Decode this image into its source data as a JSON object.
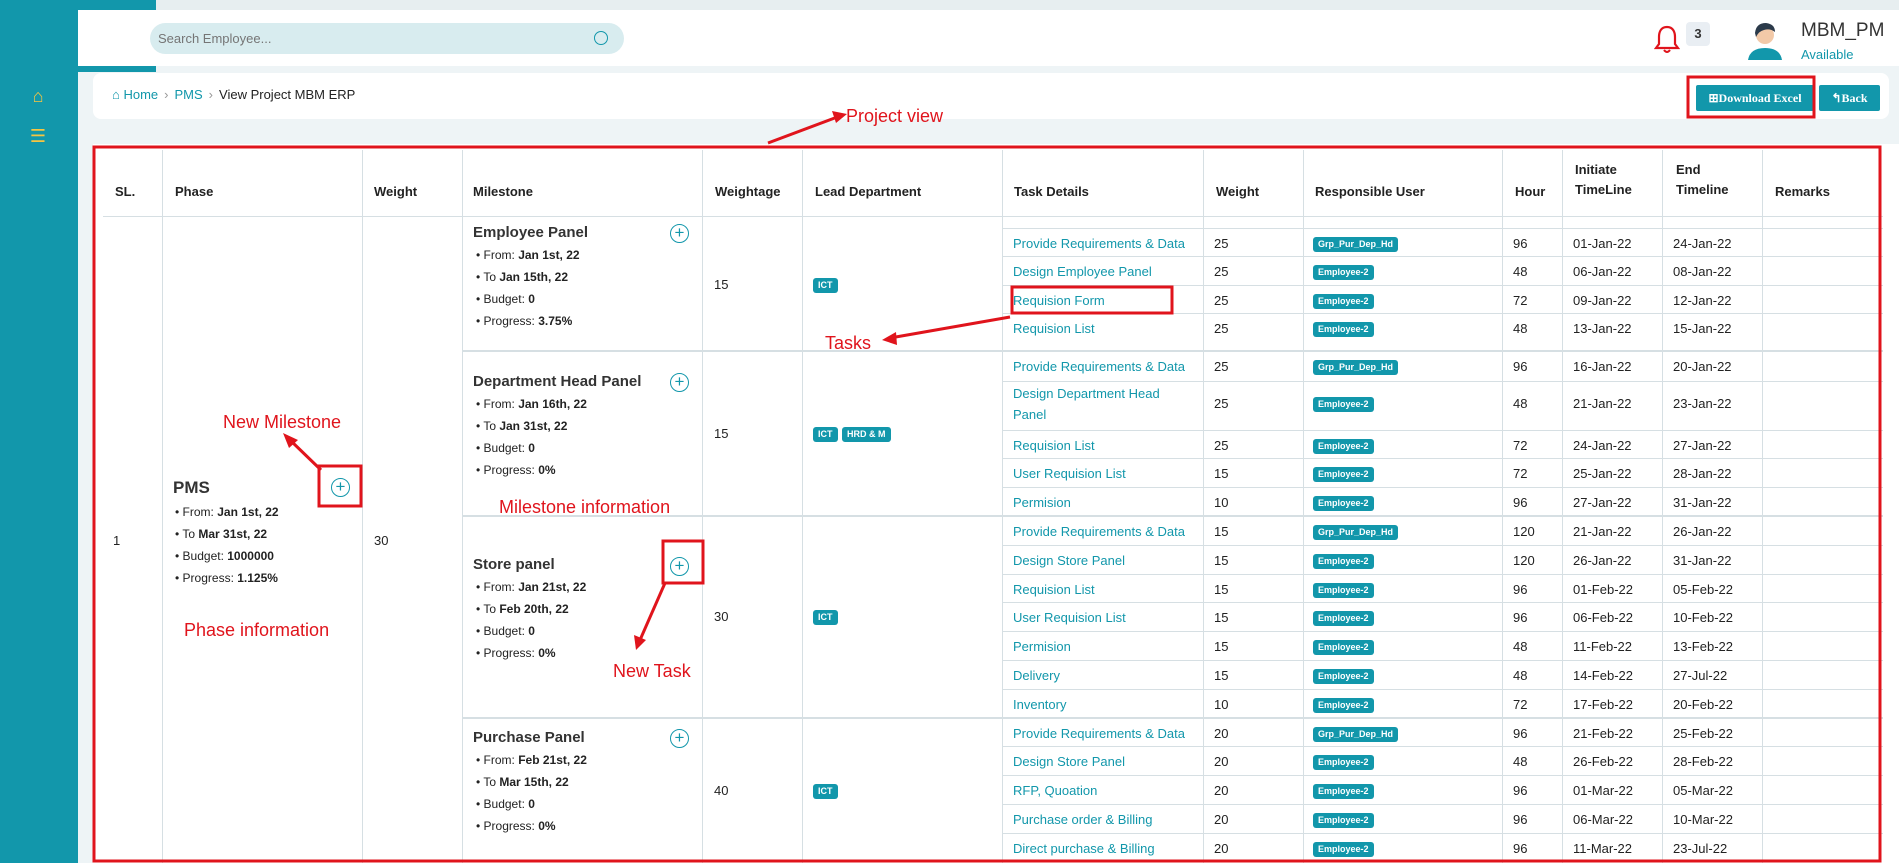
{
  "header": {
    "search_placeholder": "Search Employee...",
    "notification_count": "3",
    "user_name": "MBM_PM",
    "user_status": "Available"
  },
  "breadcrumb": {
    "home": "Home",
    "pms": "PMS",
    "current": "View Project MBM ERP"
  },
  "actions": {
    "download_excel": "⊞Download Excel",
    "back": "↰Back"
  },
  "table_headers": {
    "sl": "SL.",
    "phase": "Phase",
    "weight": "Weight",
    "milestone": "Milestone",
    "weightage": "Weightage",
    "lead_department": "Lead Department",
    "task_details": "Task Details",
    "task_weight": "Weight",
    "responsible_user": "Responsible User",
    "hour": "Hour",
    "initiate_timeline": "Initiate TimeLine",
    "end_timeline": "End Timeline",
    "remarks": "Remarks"
  },
  "phase": {
    "sl": "1",
    "name": "PMS",
    "weight": "30",
    "from_label": "From: ",
    "from": "Jan 1st, 22",
    "to_label": "To ",
    "to": "Mar 31st, 22",
    "budget_label": "Budget: ",
    "budget": "1000000",
    "progress_label": "Progress: ",
    "progress": "1.125%"
  },
  "milestones": [
    {
      "name": "Employee Panel",
      "from": "Jan 1st, 22",
      "to": "Jan 15th, 22",
      "budget": "0",
      "progress": "3.75%",
      "weightage": "15",
      "departments": [
        "ICT"
      ]
    },
    {
      "name": "Department Head Panel",
      "from": "Jan 16th, 22",
      "to": "Jan 31st, 22",
      "budget": "0",
      "progress": "0%",
      "weightage": "15",
      "departments": [
        "ICT",
        "HRD & M"
      ]
    },
    {
      "name": "Store panel",
      "from": "Jan 21st, 22",
      "to": "Feb 20th, 22",
      "budget": "0",
      "progress": "0%",
      "weightage": "30",
      "departments": [
        "ICT"
      ]
    },
    {
      "name": "Purchase Panel",
      "from": "Feb 21st, 22",
      "to": "Mar 15th, 22",
      "budget": "0",
      "progress": "0%",
      "weightage": "40",
      "departments": [
        "ICT"
      ]
    }
  ],
  "tasks": [
    {
      "name": "Provide Requirements & Data",
      "weight": "25",
      "user": "Grp_Pur_Dep_Hd",
      "hour": "96",
      "start": "01-Jan-22",
      "end": "24-Jan-22"
    },
    {
      "name": "Design Employee Panel",
      "weight": "25",
      "user": "Employee-2",
      "hour": "48",
      "start": "06-Jan-22",
      "end": "08-Jan-22"
    },
    {
      "name": "Requision Form",
      "weight": "25",
      "user": "Employee-2",
      "hour": "72",
      "start": "09-Jan-22",
      "end": "12-Jan-22"
    },
    {
      "name": "Requision List",
      "weight": "25",
      "user": "Employee-2",
      "hour": "48",
      "start": "13-Jan-22",
      "end": "15-Jan-22"
    },
    {
      "name": "Provide Requirements & Data",
      "weight": "25",
      "user": "Grp_Pur_Dep_Hd",
      "hour": "96",
      "start": "16-Jan-22",
      "end": "20-Jan-22"
    },
    {
      "name": "Design Department Head Panel",
      "weight": "25",
      "user": "Employee-2",
      "hour": "48",
      "start": "21-Jan-22",
      "end": "23-Jan-22"
    },
    {
      "name": "Requision List",
      "weight": "25",
      "user": "Employee-2",
      "hour": "72",
      "start": "24-Jan-22",
      "end": "27-Jan-22"
    },
    {
      "name": "User Requision List",
      "weight": "15",
      "user": "Employee-2",
      "hour": "72",
      "start": "25-Jan-22",
      "end": "28-Jan-22"
    },
    {
      "name": "Permision",
      "weight": "10",
      "user": "Employee-2",
      "hour": "96",
      "start": "27-Jan-22",
      "end": "31-Jan-22"
    },
    {
      "name": "Provide Requirements & Data",
      "weight": "15",
      "user": "Grp_Pur_Dep_Hd",
      "hour": "120",
      "start": "21-Jan-22",
      "end": "26-Jan-22"
    },
    {
      "name": "Design Store Panel",
      "weight": "15",
      "user": "Employee-2",
      "hour": "120",
      "start": "26-Jan-22",
      "end": "31-Jan-22"
    },
    {
      "name": "Requision List",
      "weight": "15",
      "user": "Employee-2",
      "hour": "96",
      "start": "01-Feb-22",
      "end": "05-Feb-22"
    },
    {
      "name": "User Requision List",
      "weight": "15",
      "user": "Employee-2",
      "hour": "96",
      "start": "06-Feb-22",
      "end": "10-Feb-22"
    },
    {
      "name": "Permision",
      "weight": "15",
      "user": "Employee-2",
      "hour": "48",
      "start": "11-Feb-22",
      "end": "13-Feb-22"
    },
    {
      "name": "Delivery",
      "weight": "15",
      "user": "Employee-2",
      "hour": "48",
      "start": "14-Feb-22",
      "end": "27-Jul-22"
    },
    {
      "name": "Inventory",
      "weight": "10",
      "user": "Employee-2",
      "hour": "72",
      "start": "17-Feb-22",
      "end": "20-Feb-22"
    },
    {
      "name": "Provide Requirements & Data",
      "weight": "20",
      "user": "Grp_Pur_Dep_Hd",
      "hour": "96",
      "start": "21-Feb-22",
      "end": "25-Feb-22"
    },
    {
      "name": "Design Store Panel",
      "weight": "20",
      "user": "Employee-2",
      "hour": "48",
      "start": "26-Feb-22",
      "end": "28-Feb-22"
    },
    {
      "name": "RFP, Quoation",
      "weight": "20",
      "user": "Employee-2",
      "hour": "96",
      "start": "01-Mar-22",
      "end": "05-Mar-22"
    },
    {
      "name": "Purchase order & Billing",
      "weight": "20",
      "user": "Employee-2",
      "hour": "96",
      "start": "06-Mar-22",
      "end": "10-Mar-22"
    },
    {
      "name": "Direct purchase & Billing",
      "weight": "20",
      "user": "Employee-2",
      "hour": "96",
      "start": "11-Mar-22",
      "end": "23-Jul-22"
    }
  ],
  "annotations": {
    "project_view": "Project view",
    "tasks": "Tasks",
    "new_milestone": "New Milestone",
    "milestone_information": "Milestone information",
    "phase_information": "Phase information",
    "new_task": "New Task"
  },
  "colors": {
    "primary": "#1297ab",
    "annotation": "#e0141c",
    "bell": "#e0141c"
  }
}
